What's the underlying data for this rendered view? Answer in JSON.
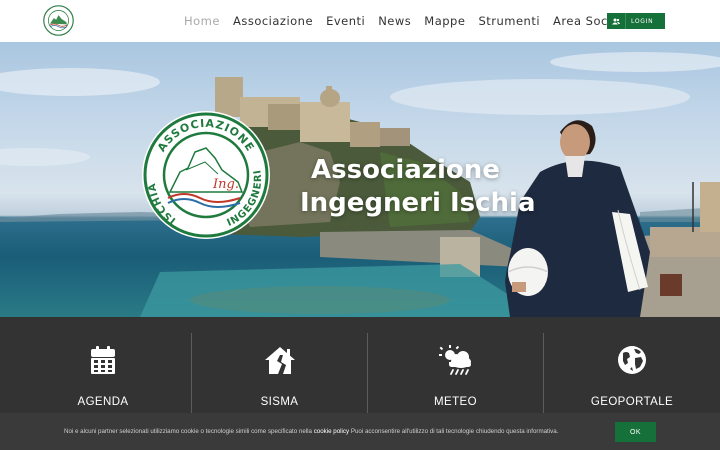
{
  "header": {
    "logo_icon": "association-logo-icon",
    "nav": [
      {
        "label": "Home",
        "active": true
      },
      {
        "label": "Associazione",
        "active": false
      },
      {
        "label": "Eventi",
        "active": false
      },
      {
        "label": "News",
        "active": false
      },
      {
        "label": "Mappe",
        "active": false
      },
      {
        "label": "Strumenti",
        "active": false
      },
      {
        "label": "Area Soci",
        "active": false
      }
    ],
    "login": {
      "label": "LOGIN",
      "icon": "users-icon"
    }
  },
  "hero": {
    "title_line1": "Associazione",
    "title_line2": "Ingegneri Ischia",
    "emblem": {
      "top_text": "ASSOCIAZIONE",
      "left_text": "ISCHIA",
      "right_text": "INGEGNERI",
      "center_text": "Ing."
    }
  },
  "features": [
    {
      "label": "AGENDA",
      "icon": "calendar-icon"
    },
    {
      "label": "SISMA",
      "icon": "house-crack-icon"
    },
    {
      "label": "METEO",
      "icon": "cloud-sun-rain-icon"
    },
    {
      "label": "GEOPORTALE",
      "icon": "globe-icon"
    }
  ],
  "cookie": {
    "text_before": "Noi e alcuni partner selezionati utilizziamo cookie o tecnologie simili come specificato nella ",
    "policy_link": "cookie policy",
    "text_after": " Puoi acconsentire all'utilizzo di tali tecnologie chiudendo questa informativa.",
    "ok_label": "OK"
  },
  "colors": {
    "brand_green": "#16703a",
    "dark_bar": "#333333",
    "nav_text": "#333333",
    "nav_active": "#a8a8a8"
  }
}
